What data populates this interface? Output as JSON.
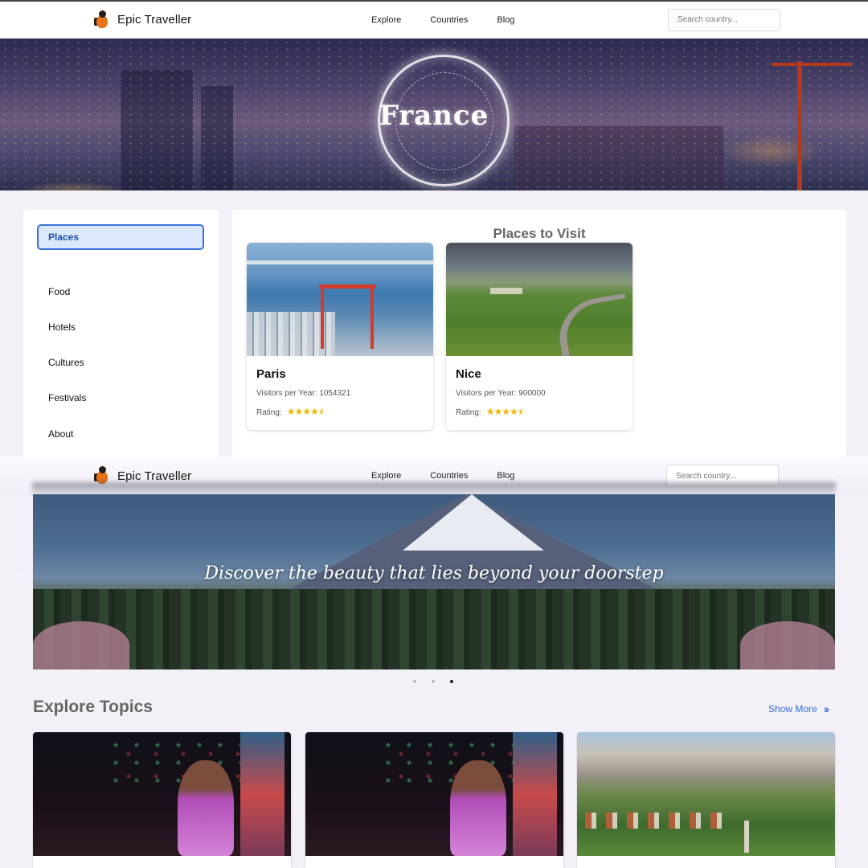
{
  "brand": {
    "name": "Epic Traveller"
  },
  "nav": {
    "links": [
      "Explore",
      "Countries",
      "Blog"
    ],
    "search_placeholder": "Search country..."
  },
  "country_hero": {
    "title": "France"
  },
  "sidebar": {
    "items": [
      {
        "label": "Places",
        "active": true
      },
      {
        "label": "Food",
        "active": false
      },
      {
        "label": "Hotels",
        "active": false
      },
      {
        "label": "Cultures",
        "active": false
      },
      {
        "label": "Festivals",
        "active": false
      },
      {
        "label": "About",
        "active": false
      }
    ]
  },
  "places": {
    "title": "Places to Visit",
    "visitors_label": "Visitors per Year:",
    "rating_label": "Rating:",
    "cards": [
      {
        "name": "Paris",
        "visitors": "1054321",
        "rating": 4.5
      },
      {
        "name": "Nice",
        "visitors": "900000",
        "rating": 4.5
      }
    ]
  },
  "home_hero": {
    "tagline": "Discover the beauty that lies beyond your doorstep",
    "slide_count": 3,
    "active_slide": 3
  },
  "topics": {
    "title": "Explore Topics",
    "show_more": "Show More"
  },
  "colors": {
    "accent": "#2f6ee0",
    "active_border": "#3a72d8",
    "star": "#f4b400"
  },
  "icons": [
    "logo-icon",
    "star-icon",
    "chevron-left-icon",
    "chevron-right-icon",
    "double-chevron-right-icon"
  ]
}
